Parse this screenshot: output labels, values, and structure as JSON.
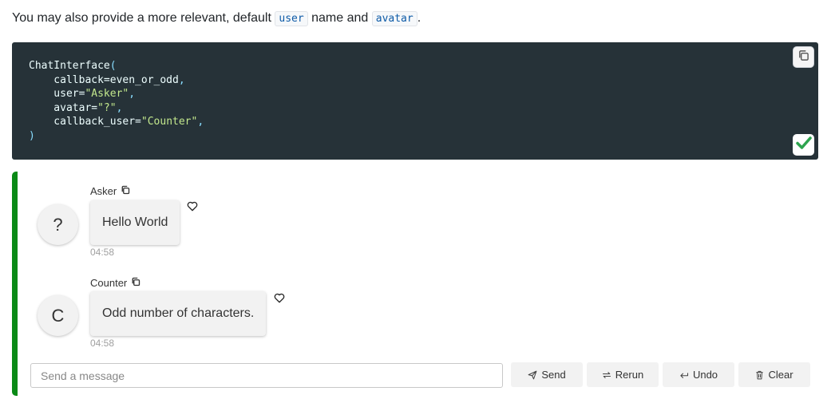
{
  "intro": {
    "before": "You may also provide a more relevant, default ",
    "code1": "user",
    "middle": " name and ",
    "code2": "avatar",
    "after": "."
  },
  "code": {
    "l1_fn": "ChatInterface",
    "l1_paren": "(",
    "l2_key": "    callback=even_or_odd",
    "l2_comma": ",",
    "l3_key": "    user=",
    "l3_str": "\"Asker\"",
    "l3_comma": ",",
    "l4_key": "    avatar=",
    "l4_str": "\"?\"",
    "l4_comma": ",",
    "l5_key": "    callback_user=",
    "l5_str": "\"Counter\"",
    "l5_comma": ",",
    "l6_paren": ")"
  },
  "icons": {
    "copy_code": "copy-icon",
    "copied": "check-icon",
    "name_copy": "copy-icon",
    "like": "heart-icon",
    "send": "send-icon",
    "rerun": "rerun-icon",
    "undo": "undo-icon",
    "clear": "trash-icon"
  },
  "colors": {
    "chat_border": "#0a8a16",
    "code_bg": "#263238",
    "check": "#2da44e"
  },
  "messages": [
    {
      "user": "Asker",
      "avatar": "?",
      "text": "Hello World",
      "time": "04:58"
    },
    {
      "user": "Counter",
      "avatar": "C",
      "text": "Odd number of characters.",
      "time": "04:58"
    }
  ],
  "composer": {
    "placeholder": "Send a message",
    "value": "",
    "send_label": "Send",
    "rerun_label": "Rerun",
    "undo_label": "Undo",
    "clear_label": "Clear"
  }
}
